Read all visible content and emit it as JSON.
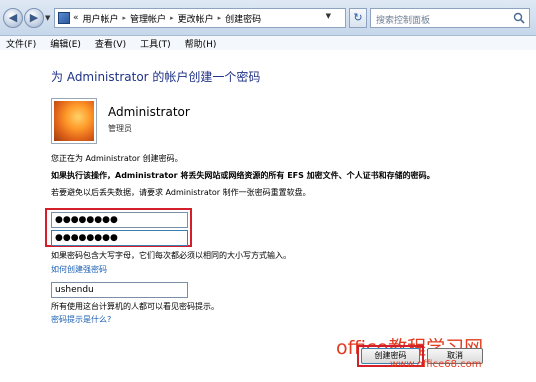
{
  "address_bar": {
    "crumb_chevron": "«",
    "breadcrumbs": [
      "用户帐户",
      "管理帐户",
      "更改帐户",
      "创建密码"
    ],
    "search_placeholder": "搜索控制面板"
  },
  "menu": [
    "文件(F)",
    "编辑(E)",
    "查看(V)",
    "工具(T)",
    "帮助(H)"
  ],
  "page": {
    "title": "为 Administrator 的帐户创建一个密码",
    "account_name": "Administrator",
    "account_role": "管理员",
    "info_line": "您正在为 Administrator 创建密码。",
    "warning_line": "如果执行该操作，Administrator 将丢失网站或网络资源的所有 EFS 加密文件、个人证书和存储的密码。",
    "advice_line": "若要避免以后丢失数据，请要求 Administrator 制作一张密码重置软盘。",
    "password_value": "●●●●●●●●",
    "confirm_value": "●●●●●●●●",
    "case_note": "如果密码包含大写字母，它们每次都必须以相同的大小写方式输入。",
    "strong_pw_link": "如何创建强密码",
    "hint_value": "ushendu",
    "hint_note": "所有使用这台计算机的人都可以看见密码提示。",
    "hint_link": "密码提示是什么?"
  },
  "buttons": {
    "create": "创建密码",
    "cancel": "取消"
  },
  "watermark": {
    "text": "office教程学习网",
    "url": "www.office68.com"
  },
  "colors": {
    "title_blue": "#1e3287",
    "link_blue": "#1a5fb4",
    "highlight_red": "#d21f2a",
    "watermark_red": "#e23a1e"
  }
}
